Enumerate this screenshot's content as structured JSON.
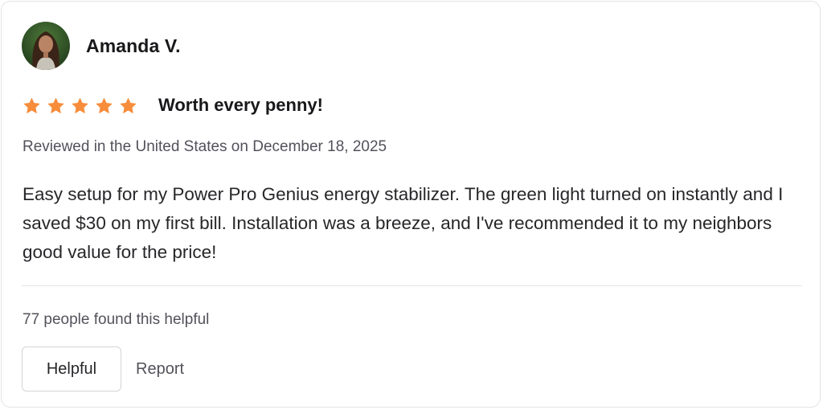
{
  "reviewer": {
    "name": "Amanda V.",
    "avatar_icon": "user-photo-avatar"
  },
  "review": {
    "rating": 5,
    "max_rating": 5,
    "star_color": "#f78c3b",
    "title": "Worth every penny!",
    "meta": "Reviewed in the United States on December 18, 2025",
    "body": "Easy setup for my Power Pro Genius energy stabilizer. The green light turned on instantly and I saved $30 on my first bill. Installation was a breeze, and I've recommended it to my neighbors good value for the price!"
  },
  "feedback": {
    "helpful_count_text": "77 people found this helpful",
    "helpful_label": "Helpful",
    "report_label": "Report"
  }
}
